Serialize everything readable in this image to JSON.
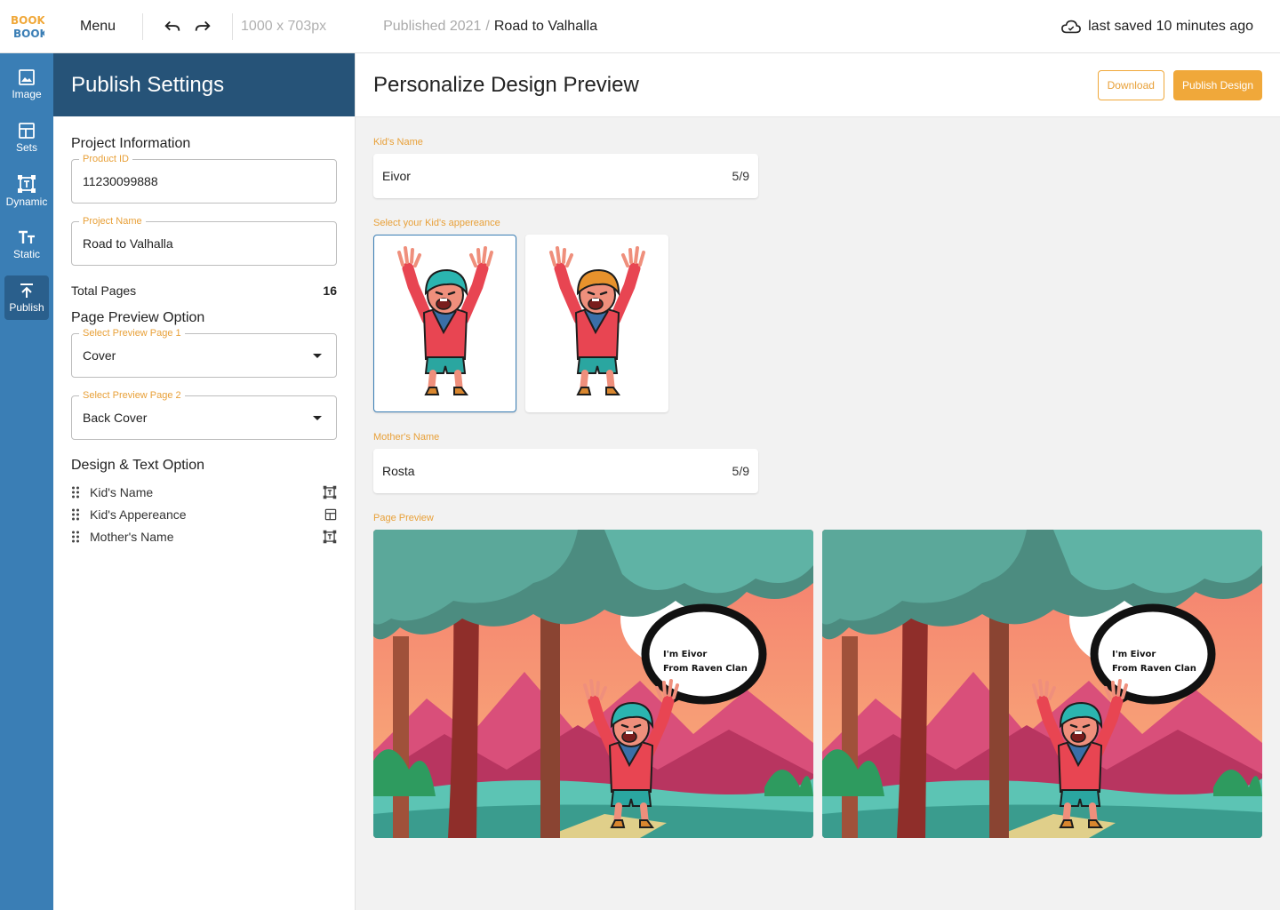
{
  "topbar": {
    "menu_label": "Menu",
    "dimensions": "1000 x 703px",
    "breadcrumb_parent": "Published 2021",
    "breadcrumb_sep": "/",
    "breadcrumb_current": "Road to Valhalla",
    "saved_status": "last saved 10 minutes ago"
  },
  "logo": {
    "line1": "BOOK",
    "line2": "BOOK"
  },
  "rail": {
    "items": [
      {
        "label": "Image",
        "icon": "image-icon"
      },
      {
        "label": "Sets",
        "icon": "sets-icon"
      },
      {
        "label": "Dynamic",
        "icon": "dynamic-text-icon"
      },
      {
        "label": "Static",
        "icon": "static-text-icon"
      },
      {
        "label": "Publish",
        "icon": "publish-icon",
        "active": true
      }
    ]
  },
  "panel": {
    "title": "Publish Settings",
    "project_info_title": "Project Information",
    "product_id_label": "Product ID",
    "product_id_value": "11230099888",
    "project_name_label": "Project Name",
    "project_name_value": "Road to Valhalla",
    "total_pages_label": "Total Pages",
    "total_pages_value": "16",
    "preview_option_title": "Page Preview Option",
    "preview_page1_label": "Select Preview Page 1",
    "preview_page1_value": "Cover",
    "preview_page2_label": "Select Preview Page 2",
    "preview_page2_value": "Back Cover",
    "design_text_title": "Design & Text Option",
    "options": [
      {
        "label": "Kid's Name",
        "icon": "dynamic-text-icon"
      },
      {
        "label": "Kid's Appereance",
        "icon": "sets-icon"
      },
      {
        "label": "Mother's Name",
        "icon": "dynamic-text-icon"
      }
    ]
  },
  "main": {
    "title": "Personalize Design Preview",
    "download_label": "Download",
    "publish_label": "Publish Design",
    "kid_name_label": "Kid's Name",
    "kid_name_value": "Eivor",
    "kid_name_count": "5/9",
    "appearance_label": "Select your Kid's appereance",
    "mother_name_label": "Mother's Name",
    "mother_name_value": "Rosta",
    "mother_name_count": "5/9",
    "page_preview_label": "Page Preview",
    "bubble_line1": "I'm Eivor",
    "bubble_line2": "From Raven Clan"
  },
  "colors": {
    "accent": "#f0a83a",
    "rail": "#3a7eb5",
    "panel_header": "#265378",
    "hair_teal": "#2bb5b0",
    "hair_orange": "#e8922c"
  }
}
